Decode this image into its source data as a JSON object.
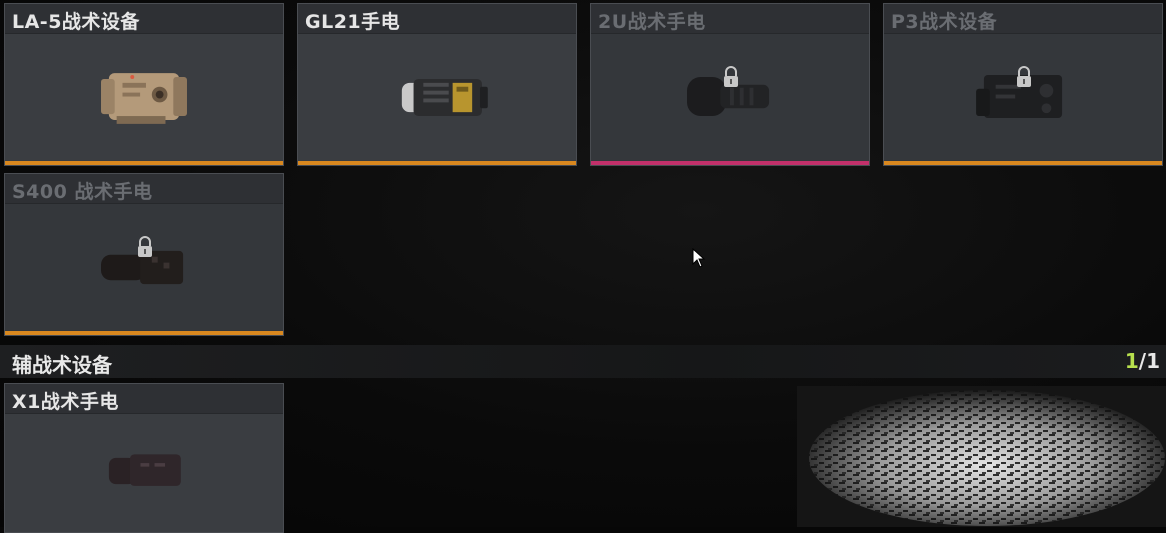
{
  "cards": [
    {
      "title": "LA-5战术设备",
      "locked": false,
      "rarity_color": "#d9881f",
      "icon": "la5-laser-device-icon"
    },
    {
      "title": "GL21手电",
      "locked": false,
      "rarity_color": "#d9881f",
      "icon": "gl21-flashlight-icon"
    },
    {
      "title": "2U战术手电",
      "locked": true,
      "rarity_color": "#c2306a",
      "icon": "2u-tactical-flashlight-icon"
    },
    {
      "title": "P3战术设备",
      "locked": true,
      "rarity_color": "#d9881f",
      "icon": "p3-tactical-device-icon"
    },
    {
      "title": "S400 战术手电",
      "locked": true,
      "rarity_color": "#d9881f",
      "icon": "s400-tactical-flashlight-icon"
    }
  ],
  "section": {
    "label": "辅战术设备",
    "count_current": "1",
    "count_sep": "/",
    "count_total": "1"
  },
  "secondary_cards": [
    {
      "title": "X1战术手电",
      "locked": false,
      "icon": "x1-tactical-flashlight-icon"
    }
  ],
  "preview": {
    "icon": "flashlight-beam-preview-icon"
  },
  "colors": {
    "accent_green": "#b7e04e",
    "rarity_orange": "#d9881f",
    "rarity_magenta": "#c2306a"
  }
}
